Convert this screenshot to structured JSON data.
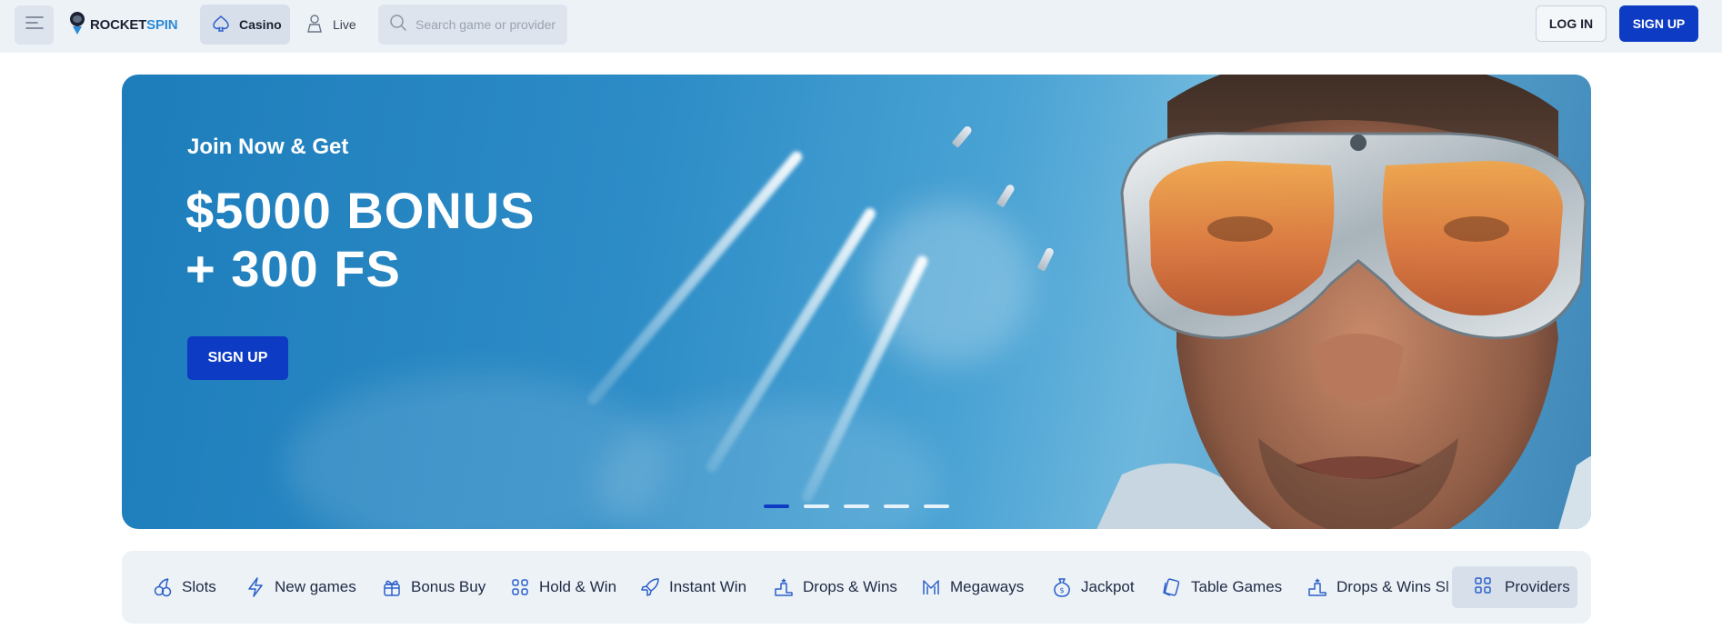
{
  "header": {
    "logo": {
      "text_main": "ROCKET",
      "text_accent": "SPIN"
    },
    "nav": [
      {
        "label": "Casino",
        "icon": "spade-icon",
        "active": true
      },
      {
        "label": "Live",
        "icon": "dealer-icon",
        "active": false
      }
    ],
    "search": {
      "placeholder": "Search game or provider"
    },
    "login_label": "LOG IN",
    "signup_label": "SIGN UP"
  },
  "hero": {
    "subtitle": "Join Now & Get",
    "title_line1": "$5000 BONUS",
    "title_line2": "+ 300 FS",
    "cta_label": "SIGN UP",
    "slides_count": 5,
    "active_slide": 1
  },
  "categories": [
    {
      "label": "Slots",
      "icon": "cherries-icon"
    },
    {
      "label": "New games",
      "icon": "lightning-icon"
    },
    {
      "label": "Bonus Buy",
      "icon": "gift-icon"
    },
    {
      "label": "Hold & Win",
      "icon": "grid-dots-icon"
    },
    {
      "label": "Instant Win",
      "icon": "rocket-icon"
    },
    {
      "label": "Drops & Wins",
      "icon": "podium-icon"
    },
    {
      "label": "Megaways",
      "icon": "megaways-icon"
    },
    {
      "label": "Jackpot",
      "icon": "money-bag-icon"
    },
    {
      "label": "Table Games",
      "icon": "cards-icon"
    },
    {
      "label": "Drops & Wins Sl",
      "icon": "podium-icon"
    }
  ],
  "providers_label": "Providers",
  "colors": {
    "brand": "#0d3bc4",
    "accent": "#2b8bd6",
    "bar_bg": "#edf2f7"
  }
}
